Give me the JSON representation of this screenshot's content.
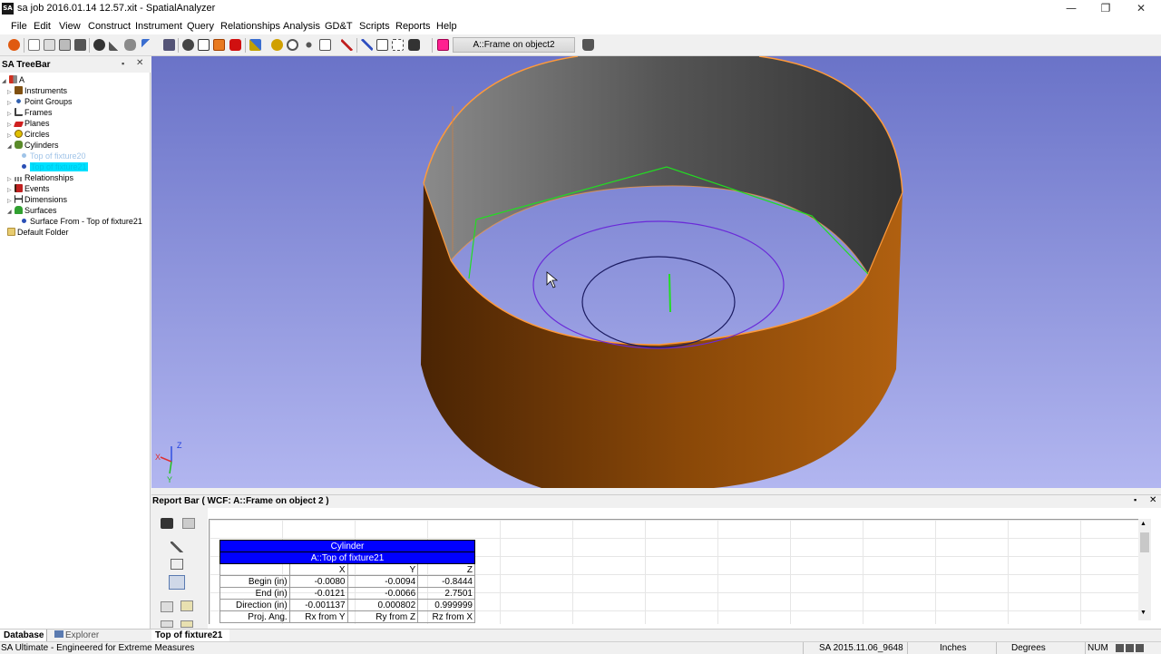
{
  "window": {
    "app_icon": "SA",
    "title": "sa job 2016.01.14 12.57.xit - SpatialAnalyzer",
    "controls": {
      "minimize": "—",
      "restore": "❐",
      "close": "✕"
    }
  },
  "menu": [
    "File",
    "Edit",
    "View",
    "Construct",
    "Instrument",
    "Query",
    "Relationships",
    "Analysis",
    "GD&T",
    "Scripts",
    "Reports",
    "Help"
  ],
  "toolbar": {
    "active_frame": "A::Frame on object2",
    "icons": [
      "stop-icon",
      "new-icon",
      "open-icon",
      "save-icon",
      "save-as-icon",
      "settings-icon",
      "measure-icon",
      "probe-icon",
      "instrument-icon",
      "laser-icon",
      "view-icon",
      "cube-icon",
      "shade-icon",
      "solid-icon",
      "color-icon",
      "point-icon",
      "zoom-icon",
      "rotate-icon",
      "select-icon",
      "check-icon",
      "cursor-icon",
      "window-icon",
      "select-box-icon",
      "camera-icon",
      "color-swatch-icon",
      "lock-icon"
    ]
  },
  "treebar": {
    "title": "SA TreeBar",
    "pin": "▪",
    "close": "✕",
    "items": [
      {
        "label": "A",
        "icon": "collection-icon",
        "expander": "◢",
        "color": "#d03020"
      },
      {
        "label": "Instruments",
        "icon": "instrument-icon",
        "expander": "▷",
        "color": "#805010"
      },
      {
        "label": "Point Groups",
        "icon": "point-group-icon",
        "expander": "▷",
        "color": "#3060b0"
      },
      {
        "label": "Frames",
        "icon": "frame-icon",
        "expander": "▷",
        "color": "#404040"
      },
      {
        "label": "Planes",
        "icon": "plane-icon",
        "expander": "▷",
        "color": "#d02020"
      },
      {
        "label": "Circles",
        "icon": "circle-icon",
        "expander": "▷",
        "color": "#e0c000"
      },
      {
        "label": "Cylinders",
        "icon": "cylinder-icon",
        "expander": "◢",
        "color": "#5a8a2a"
      },
      {
        "label": "Top of fixture20",
        "icon": "cylinder-item-icon",
        "expander": "",
        "color": "#a0c4e8",
        "state": "hidden"
      },
      {
        "label": "Top of fixture21",
        "icon": "cylinder-item-icon",
        "expander": "",
        "color": "#00e0ff",
        "state": "selected"
      },
      {
        "label": "Relationships",
        "icon": "relationship-icon",
        "expander": "▷",
        "color": "#808080"
      },
      {
        "label": "Events",
        "icon": "event-icon",
        "expander": "▷",
        "color": "#c02020"
      },
      {
        "label": "Dimensions",
        "icon": "dimension-icon",
        "expander": "▷",
        "color": "#202020"
      },
      {
        "label": "Surfaces",
        "icon": "surface-icon",
        "expander": "◢",
        "color": "#30a030"
      },
      {
        "label": "Surface From - Top of fixture21",
        "icon": "surface-item-icon",
        "expander": "",
        "color": "#2a4fb5"
      },
      {
        "label": "Default Folder",
        "icon": "folder-icon",
        "expander": "",
        "color": "#e8cc70"
      }
    ]
  },
  "viewport": {
    "axes": {
      "z": "Z",
      "x": "X",
      "y": "Y"
    },
    "colors": {
      "bg_top": "#6a73c8",
      "bg_bottom": "#b2b6f0",
      "cylinder_outer": "#7a3f0a",
      "cylinder_inner": "#555555",
      "edge": "#ff9a3a",
      "fit_lines": "#22dd22",
      "circle1": "#6a2ad8",
      "circle2": "#1a1a60"
    }
  },
  "reportbar": {
    "title": "Report Bar ( WCF: A::Frame on object 2 )",
    "pin": "▪",
    "close": "✕",
    "table": {
      "title": "Cylinder",
      "subtitle": "A::Top of fixture21",
      "columns": [
        "",
        "X",
        "Y",
        "Z"
      ],
      "rows": [
        [
          "Begin (in)",
          "-0.0080",
          "-0.0094",
          "-0.8444"
        ],
        [
          "End (in)",
          "-0.0121",
          "-0.0066",
          "2.7501"
        ],
        [
          "Direction (in)",
          "-0.001137",
          "0.000802",
          "0.999999"
        ],
        [
          "Proj. Ang.",
          "Rx from Y",
          "Ry from Z",
          "Rz from X"
        ]
      ]
    },
    "scroll": {
      "up": "▲",
      "down": "▼"
    }
  },
  "bottom_tabs": [
    {
      "label": "Database",
      "active": true
    },
    {
      "label": "Explorer",
      "active": false
    },
    {
      "label": "Top of fixture21",
      "active": true
    }
  ],
  "status": {
    "tagline": "SA Ultimate - Engineered for Extreme Measures",
    "version": "SA 2015.11.06_9648",
    "units": "Inches",
    "angle": "Degrees",
    "num": "NUM"
  }
}
